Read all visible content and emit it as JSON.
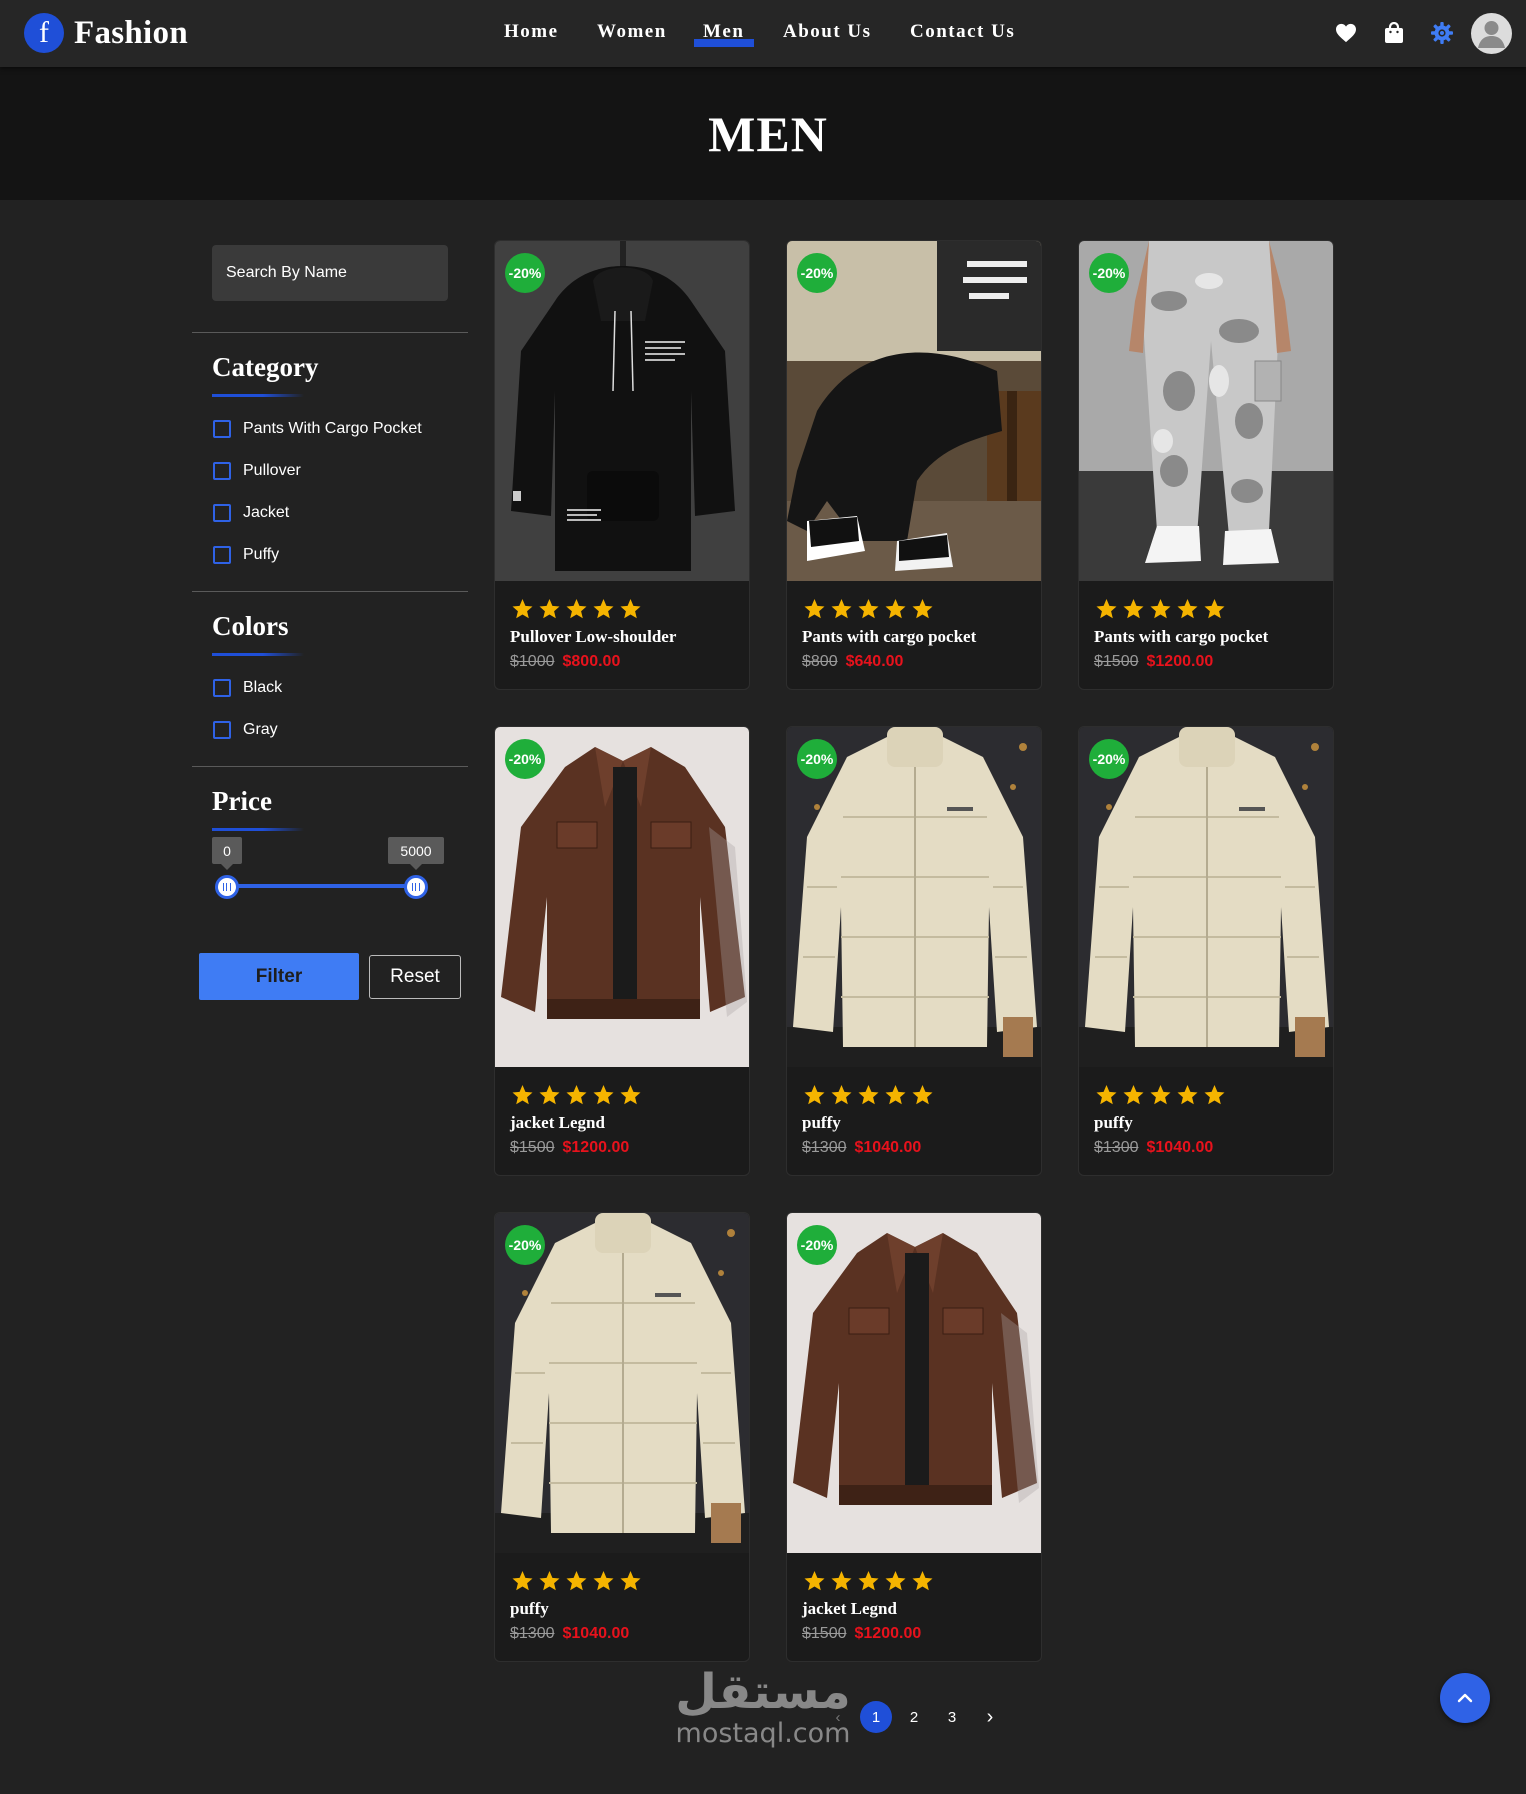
{
  "brand": {
    "logo_letter": "f",
    "name": "Fashion",
    "color": "#1f4fd8"
  },
  "nav": {
    "links": [
      "Home",
      "Women",
      "Men",
      "About Us",
      "Contact Us"
    ],
    "active": "Men",
    "icons": [
      "heart-icon",
      "shopping-bag-icon",
      "settings-gear-icon",
      "user-avatar-icon"
    ]
  },
  "hero": {
    "title": "MEN"
  },
  "sidebar": {
    "search": {
      "placeholder": "Search By Name",
      "value": ""
    },
    "category": {
      "title": "Category",
      "items": [
        "Pants With Cargo Pocket",
        "Pullover",
        "Jacket",
        "Puffy"
      ]
    },
    "colors": {
      "title": "Colors",
      "items": [
        "Black",
        "Gray"
      ]
    },
    "price": {
      "title": "Price",
      "min": "0",
      "max": "5000"
    },
    "filter_label": "Filter",
    "reset_label": "Reset"
  },
  "products": [
    {
      "name": "Pullover Low-shoulder",
      "old_price": "$1000",
      "new_price": "$800.00",
      "discount": "-20%",
      "rating": 5,
      "image": "black-hoodie"
    },
    {
      "name": "Pants with cargo pocket",
      "old_price": "$800",
      "new_price": "$640.00",
      "discount": "-20%",
      "rating": 5,
      "image": "black-cargo-pants"
    },
    {
      "name": "Pants with cargo pocket",
      "old_price": "$1500",
      "new_price": "$1200.00",
      "discount": "-20%",
      "rating": 5,
      "image": "camo-cargo-pants"
    },
    {
      "name": "jacket Legnd",
      "old_price": "$1500",
      "new_price": "$1200.00",
      "discount": "-20%",
      "rating": 5,
      "image": "brown-leather-jacket"
    },
    {
      "name": "puffy",
      "old_price": "$1300",
      "new_price": "$1040.00",
      "discount": "-20%",
      "rating": 5,
      "image": "cream-puffer-jacket"
    },
    {
      "name": "puffy",
      "old_price": "$1300",
      "new_price": "$1040.00",
      "discount": "-20%",
      "rating": 5,
      "image": "cream-puffer-jacket"
    },
    {
      "name": "puffy",
      "old_price": "$1300",
      "new_price": "$1040.00",
      "discount": "-20%",
      "rating": 5,
      "image": "cream-puffer-jacket"
    },
    {
      "name": "jacket Legnd",
      "old_price": "$1500",
      "new_price": "$1200.00",
      "discount": "-20%",
      "rating": 5,
      "image": "brown-leather-jacket"
    }
  ],
  "pagination": {
    "prev": "‹",
    "pages": [
      "1",
      "2",
      "3"
    ],
    "active": "1",
    "next": "›"
  },
  "watermark": {
    "arabic": "مستقل",
    "latin": "mostaql.com"
  },
  "colors": {
    "accent": "#1f4fd8",
    "button": "#3f7cf4",
    "sale": "#e8121c",
    "badge": "#1fae3a",
    "star": "#f5b400"
  }
}
